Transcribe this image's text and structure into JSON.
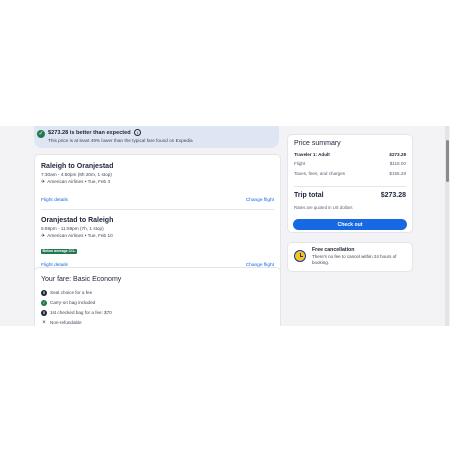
{
  "banner": {
    "title": "$273.28 is better than expected",
    "subtitle": "This price is at least 49% lower than the typical fare found on Expedia"
  },
  "flights": [
    {
      "title": "Raleigh to Oranjestad",
      "times": "7:30am - 4:50pm (8h 20m, 1 stop)",
      "airline": "American Airlines • Tue, Feb 3",
      "details_label": "Flight details",
      "change_label": "Change flight"
    },
    {
      "title": "Oranjestad to Raleigh",
      "times": "5:59pm - 11:59pm (7h, 1 stop)",
      "airline": "American Airlines • Tue, Feb 10",
      "badge": "Below average CO₂",
      "details_label": "Flight details",
      "change_label": "Change flight"
    }
  ],
  "fare": {
    "title": "Your fare: Basic Economy",
    "items": [
      {
        "text": "Seat choice for a fee",
        "icon": "dollar-icon"
      },
      {
        "text": "Carry-on bag included",
        "icon": "check-icon"
      },
      {
        "text": "1st checked bag for a fee: $70",
        "icon": "dollar-icon"
      },
      {
        "text": "Non-refundable",
        "icon": "x-icon"
      }
    ]
  },
  "summary": {
    "title": "Price summary",
    "traveler_label": "Traveler 1: Adult",
    "traveler_value": "$273.28",
    "flight_label": "Flight",
    "flight_value": "$118.00",
    "taxes_label": "Taxes, fees, and charges",
    "taxes_value": "$155.28",
    "total_label": "Trip total",
    "total_value": "$273.28",
    "quoted_note": "Rates are quoted in US dollars",
    "checkout_label": "Check out"
  },
  "cancellation": {
    "title": "Free cancellation",
    "text": "There's no fee to cancel within 24 hours of booking."
  },
  "colors": {
    "accent": "#1668e3",
    "success": "#227950",
    "banner_bg": "#dfe6f3",
    "page_bg": "#f3f3f5"
  }
}
